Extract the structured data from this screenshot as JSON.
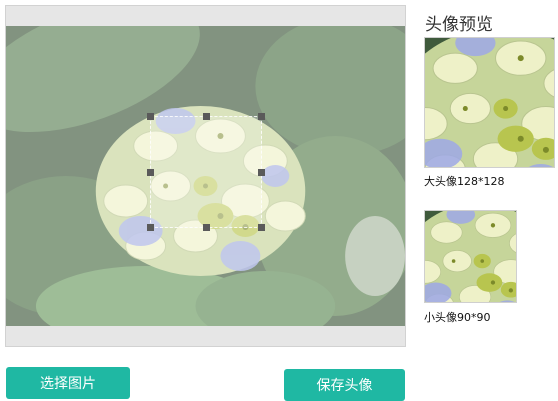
{
  "preview": {
    "title": "头像预览",
    "large_label": "大头像128*128",
    "small_label": "小头像90*90"
  },
  "buttons": {
    "select_image": "选择图片",
    "save_avatar": "保存头像"
  },
  "colors": {
    "button_bg": "#1fb8a3",
    "button_text": "#ffffff",
    "crop_bg": "#e6e6e6"
  },
  "icons": {
    "crop_handles": "square-handle"
  }
}
